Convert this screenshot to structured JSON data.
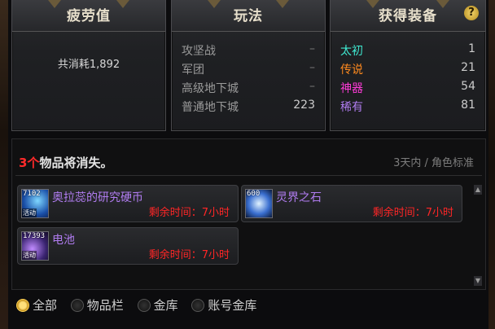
{
  "panels": {
    "fatigue": {
      "title": "疲劳值",
      "total_label": "共消耗1,892"
    },
    "gameplay": {
      "title": "玩法",
      "rows": [
        {
          "label": "攻坚战",
          "value": "–"
        },
        {
          "label": "军团",
          "value": "–"
        },
        {
          "label": "高级地下城",
          "value": "–"
        },
        {
          "label": "普通地下城",
          "value": "223"
        }
      ]
    },
    "equipment": {
      "title": "获得装备",
      "help": "?",
      "rows": [
        {
          "label": "太初",
          "value": "1",
          "color": "#3fe8d0"
        },
        {
          "label": "传说",
          "value": "21",
          "color": "#ff8a1e"
        },
        {
          "label": "神器",
          "value": "54",
          "color": "#ff3bd8"
        },
        {
          "label": "稀有",
          "value": "81",
          "color": "#b07cf0"
        }
      ]
    }
  },
  "expiring": {
    "count": "3个",
    "message": "物品将消失。",
    "filter_info": "3天内 / 角色标准",
    "items": [
      {
        "qty": "7102",
        "tag": "活动",
        "name": "奥拉蕊的研究硬币",
        "time": "剩余时间：7小时",
        "icon": "coin-icon"
      },
      {
        "qty": "600",
        "tag": "",
        "name": "灵界之石",
        "time": "剩余时间：7小时",
        "icon": "crystal-icon"
      },
      {
        "qty": "17393",
        "tag": "活动",
        "name": "电池",
        "time": "剩余时间：7小时",
        "icon": "battery-icon"
      }
    ]
  },
  "filters": {
    "options": [
      "全部",
      "物品栏",
      "金库",
      "账号金库"
    ],
    "selected": "全部"
  }
}
